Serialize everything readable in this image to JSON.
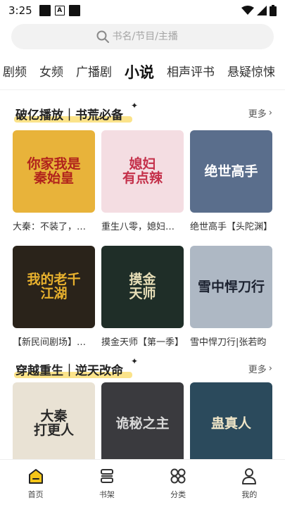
{
  "status": {
    "time": "3:25",
    "badge": "A"
  },
  "search": {
    "placeholder": "书名/节目/主播"
  },
  "tabs": [
    {
      "label": "剧频"
    },
    {
      "label": "女频"
    },
    {
      "label": "广播剧"
    },
    {
      "label": "小说"
    },
    {
      "label": "相声评书"
    },
    {
      "label": "悬疑惊悚"
    }
  ],
  "active_tab": "小说",
  "sections": [
    {
      "title": "破亿播放｜书荒必备",
      "more": "更多",
      "rows": [
        [
          {
            "name": "大秦：不装了，我是秦始皇",
            "cover_text": "你家我是\n秦始皇",
            "cover_bg": "#e8b33a",
            "cover_fg": "#b0221c"
          },
          {
            "name": "重生八零，媳妇有点辣",
            "cover_text": "媳妇\n有点辣",
            "cover_bg": "#f4dde2",
            "cover_fg": "#c4304a"
          },
          {
            "name": "绝世高手【头陀渊】",
            "cover_text": "绝世高手",
            "cover_bg": "#5a6e8c",
            "cover_fg": "#ffffff"
          }
        ],
        [
          {
            "name": "【新民间剧场】我的老千江湖",
            "cover_text": "我的老千\n江湖",
            "cover_bg": "#2a231a",
            "cover_fg": "#e8b12e"
          },
          {
            "name": "摸金天师【第一季】",
            "cover_text": "摸金\n天师",
            "cover_bg": "#1f2e28",
            "cover_fg": "#e8dfb8"
          },
          {
            "name": "雪中悍刀行|张若昀",
            "cover_text": "雪中悍刀行",
            "cover_bg": "#aeb8c4",
            "cover_fg": "#1c2230"
          }
        ]
      ]
    },
    {
      "title": "穿越重生｜逆天改命",
      "more": "更多",
      "rows": [
        [
          {
            "name": "大秦：打更人",
            "cover_text": "大秦\n打更人",
            "cover_bg": "#e9e2d4",
            "cover_fg": "#2a2a2a"
          },
          {
            "name": "诡秘之主",
            "cover_text": "诡秘之主",
            "cover_bg": "#3a3a3e",
            "cover_fg": "#d9d9d9"
          },
          {
            "name": "蛊真人",
            "cover_text": "蛊真人",
            "cover_bg": "#2b4a5c",
            "cover_fg": "#f0e6c8"
          }
        ]
      ]
    }
  ],
  "bottom_nav": [
    {
      "label": "首页",
      "icon": "home-icon",
      "active": true
    },
    {
      "label": "书架",
      "icon": "bookshelf-icon"
    },
    {
      "label": "分类",
      "icon": "category-icon"
    },
    {
      "label": "我的",
      "icon": "profile-icon"
    }
  ],
  "colors": {
    "accent": "#f5c518",
    "highlight": "#fbe38a"
  }
}
